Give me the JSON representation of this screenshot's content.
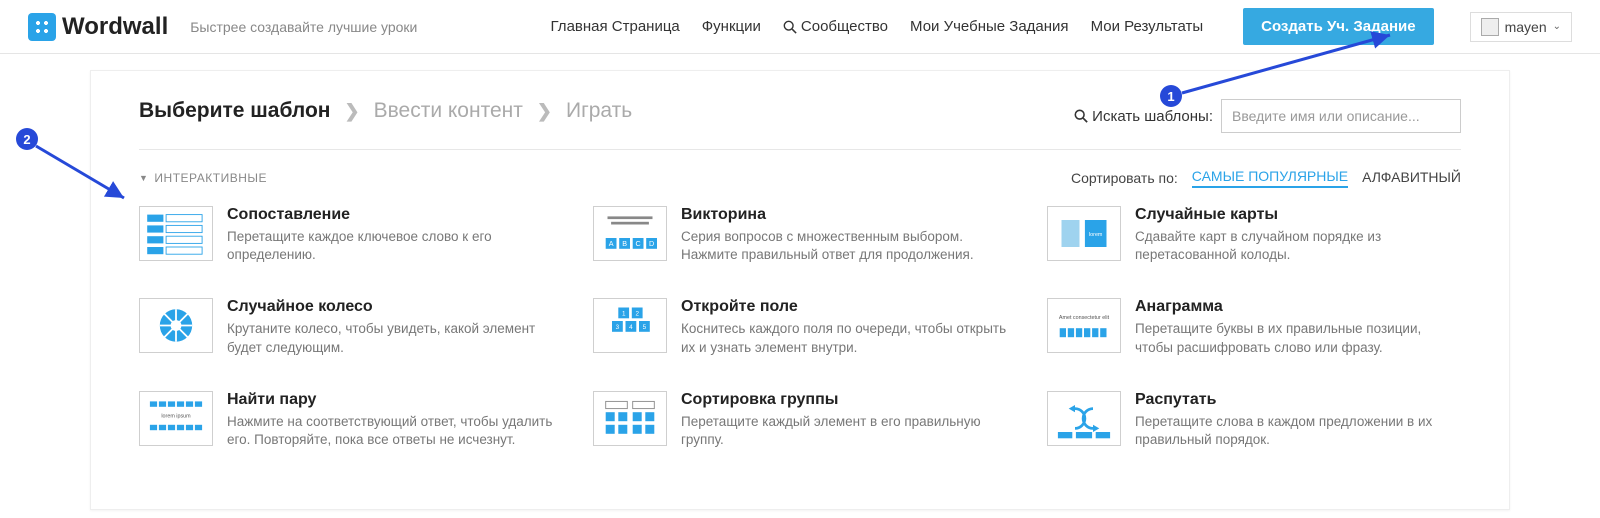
{
  "header": {
    "brand": "Wordwall",
    "tagline": "Быстрее создавайте лучшие уроки",
    "nav": {
      "home": "Главная Страница",
      "features": "Функции",
      "community": "Сообщество",
      "my_activities": "Мои Учебные Задания",
      "my_results": "Мои Результаты"
    },
    "create_button": "Создать Уч. Задание",
    "user": {
      "name": "mayen"
    }
  },
  "steps": {
    "s1": "Выберите шаблон",
    "s2": "Ввести контент",
    "s3": "Играть"
  },
  "search": {
    "label": "Искать шаблоны:",
    "placeholder": "Введите имя или описание..."
  },
  "section": {
    "interactives": "ИНТЕРАКТИВНЫЕ"
  },
  "sort": {
    "label": "Сортировать по:",
    "popular": "САМЫЕ ПОПУЛЯРНЫЕ",
    "alpha": "АЛФАВИТНЫЙ"
  },
  "templates": [
    {
      "id": "match-up",
      "title": "Сопоставление",
      "desc": "Перетащите каждое ключевое слово к его определению."
    },
    {
      "id": "quiz",
      "title": "Викторина",
      "desc": "Серия вопросов с множественным выбором. Нажмите правильный ответ для продолжения."
    },
    {
      "id": "random-cards",
      "title": "Случайные карты",
      "desc": "Сдавайте карт в случайном порядке из перетасованной колоды."
    },
    {
      "id": "random-wheel",
      "title": "Случайное колесо",
      "desc": "Крутаните колесо, чтобы увидеть, какой элемент будет следующим."
    },
    {
      "id": "open-the-box",
      "title": "Откройте поле",
      "desc": "Коснитесь каждого поля по очереди, чтобы открыть их и узнать элемент внутри."
    },
    {
      "id": "anagram",
      "title": "Анаграмма",
      "desc": "Перетащите буквы в их правильные позиции, чтобы расшифровать слово или фразу."
    },
    {
      "id": "find-the-match",
      "title": "Найти пару",
      "desc": "Нажмите на соответствующий ответ, чтобы удалить его. Повторяйте, пока все ответы не исчезнут."
    },
    {
      "id": "group-sort",
      "title": "Сортировка группы",
      "desc": "Перетащите каждый элемент в его правильную группу."
    },
    {
      "id": "unjumble",
      "title": "Распутать",
      "desc": "Перетащите слова в каждом предложении в их правильный порядок."
    }
  ],
  "annotations": {
    "a1": "1",
    "a2": "2"
  }
}
